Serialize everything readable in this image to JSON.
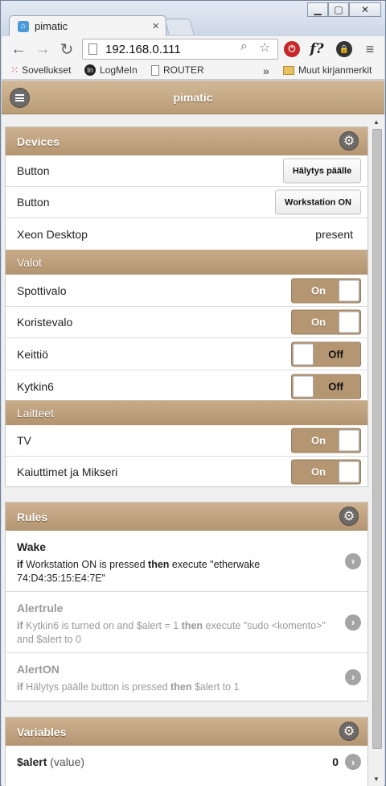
{
  "browser": {
    "tab_title": "pimatic",
    "tab_close": "×",
    "url": "192.168.0.111",
    "bookmarks": [
      {
        "label": "Sovellukset",
        "icon": "apps-grid-icon"
      },
      {
        "label": "LogMeIn",
        "icon": "logmein-icon"
      },
      {
        "label": "ROUTER",
        "icon": "page-icon"
      }
    ],
    "bookmarks_overflow": "»",
    "other_bookmarks": "Muut kirjanmerkit",
    "ext_f": "f?"
  },
  "app": {
    "title": "pimatic"
  },
  "devices": {
    "header": "Devices",
    "rows": [
      {
        "label": "Button",
        "type": "button",
        "button_label": "Hälytys päälle"
      },
      {
        "label": "Button",
        "type": "button",
        "button_label": "Workstation ON"
      },
      {
        "label": "Xeon Desktop",
        "type": "value",
        "value": "present"
      }
    ],
    "groups": [
      {
        "header": "Valot",
        "rows": [
          {
            "label": "Spottivalo",
            "state": "on",
            "state_label": "On"
          },
          {
            "label": "Koristevalo",
            "state": "on",
            "state_label": "On"
          },
          {
            "label": "Keittiö",
            "state": "off",
            "state_label": "Off"
          },
          {
            "label": "Kytkin6",
            "state": "off",
            "state_label": "Off"
          }
        ]
      },
      {
        "header": "Laitteet",
        "rows": [
          {
            "label": "TV",
            "state": "on",
            "state_label": "On"
          },
          {
            "label": "Kaiuttimet ja Mikseri",
            "state": "on",
            "state_label": "On"
          }
        ]
      }
    ]
  },
  "rules": {
    "header": "Rules",
    "items": [
      {
        "name": "Wake",
        "enabled": true,
        "if": "if",
        "condition": " Workstation ON is pressed ",
        "then": "then",
        "action": " execute \"etherwake 74:D4:35:15:E4:7E\""
      },
      {
        "name": "Alertrule",
        "enabled": false,
        "if": "if",
        "condition": " Kytkin6 is turned on and $alert = 1 ",
        "then": "then",
        "action": " execute \"sudo <komento>\" and $alert to 0"
      },
      {
        "name": "AlertON",
        "enabled": false,
        "if": "if",
        "condition": " Hälytys päälle button is pressed ",
        "then": "then",
        "action": " $alert to 1"
      }
    ]
  },
  "variables": {
    "header": "Variables",
    "items": [
      {
        "name": "$alert",
        "kind": "(value)",
        "value": "0"
      }
    ]
  },
  "colors": {
    "header_tan": "#b99c77",
    "toggle_tan": "#b59673",
    "disabled_text": "#9a9a9a"
  }
}
